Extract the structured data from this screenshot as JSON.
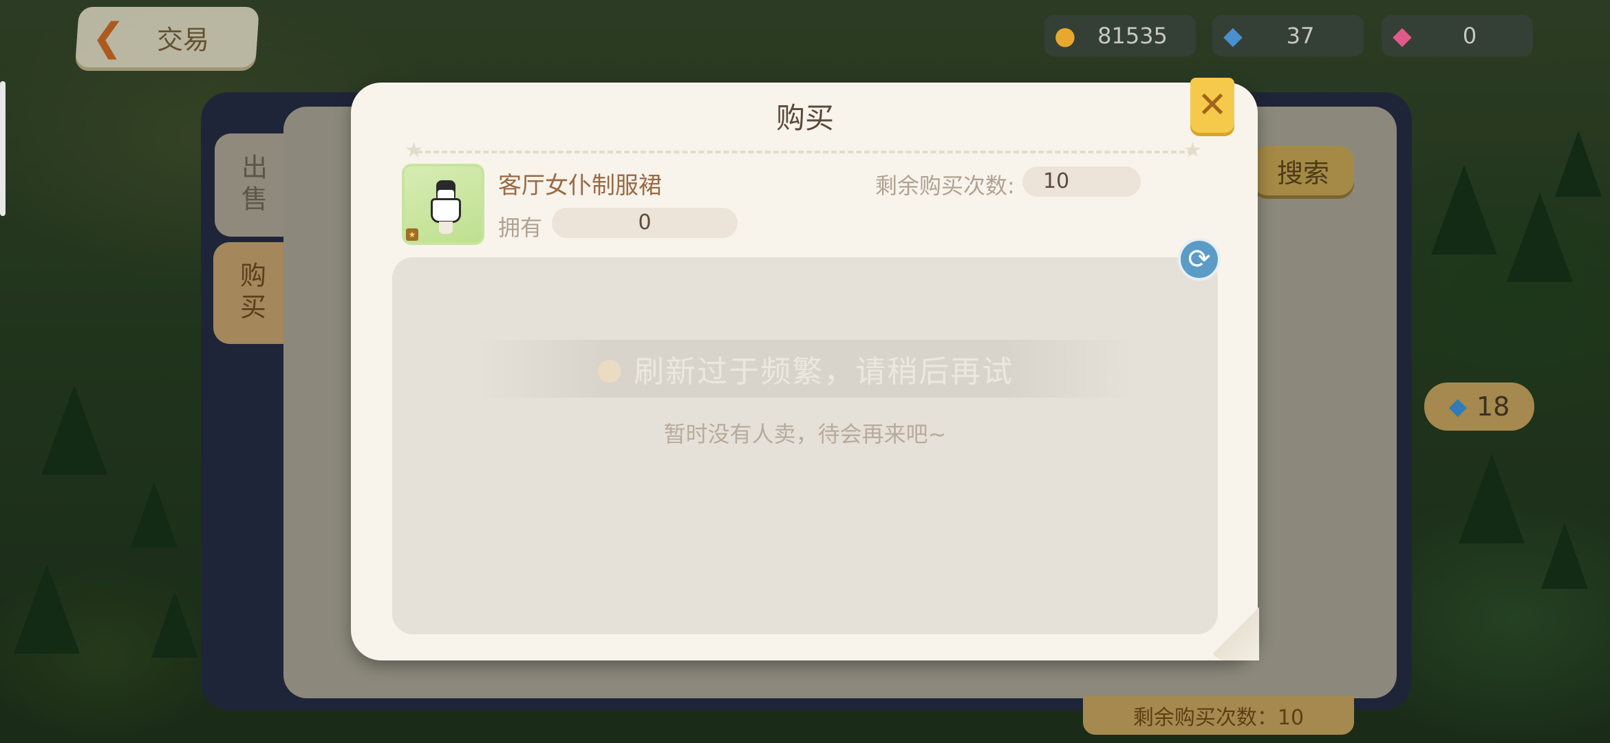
{
  "header": {
    "back_icon": "back-arrow-icon",
    "title": "交易"
  },
  "currencies": [
    {
      "icon": "gold-coin-icon",
      "value": "81535"
    },
    {
      "icon": "blue-gem-plus-icon",
      "value": "37"
    },
    {
      "icon": "pink-diamond-plus-icon",
      "value": "0"
    }
  ],
  "background_panel": {
    "tabs": {
      "sell": "出售",
      "buy": "购买"
    },
    "search_label": "搜索",
    "gem_badge_value": "18",
    "remain_text": "剩余购买次数：10"
  },
  "modal": {
    "title": "购买",
    "close_icon": "close-x-icon",
    "item": {
      "icon": "maid-dress-item-icon",
      "name": "客厅女仆制服裙",
      "remain_label": "剩余购买次数:",
      "remain_value": "10",
      "own_label": "拥有",
      "own_value": "0"
    },
    "refresh_icon": "refresh-icon",
    "toast": "刷新过于频繁，请稍后再试",
    "empty_message": "暂时没有人卖，待会再来吧~"
  },
  "colors": {
    "accent_yellow": "#f5c94a",
    "modal_bg": "#f8f4ec",
    "item_name": "#9a6a44",
    "refresh_blue": "#5a9cc7"
  }
}
